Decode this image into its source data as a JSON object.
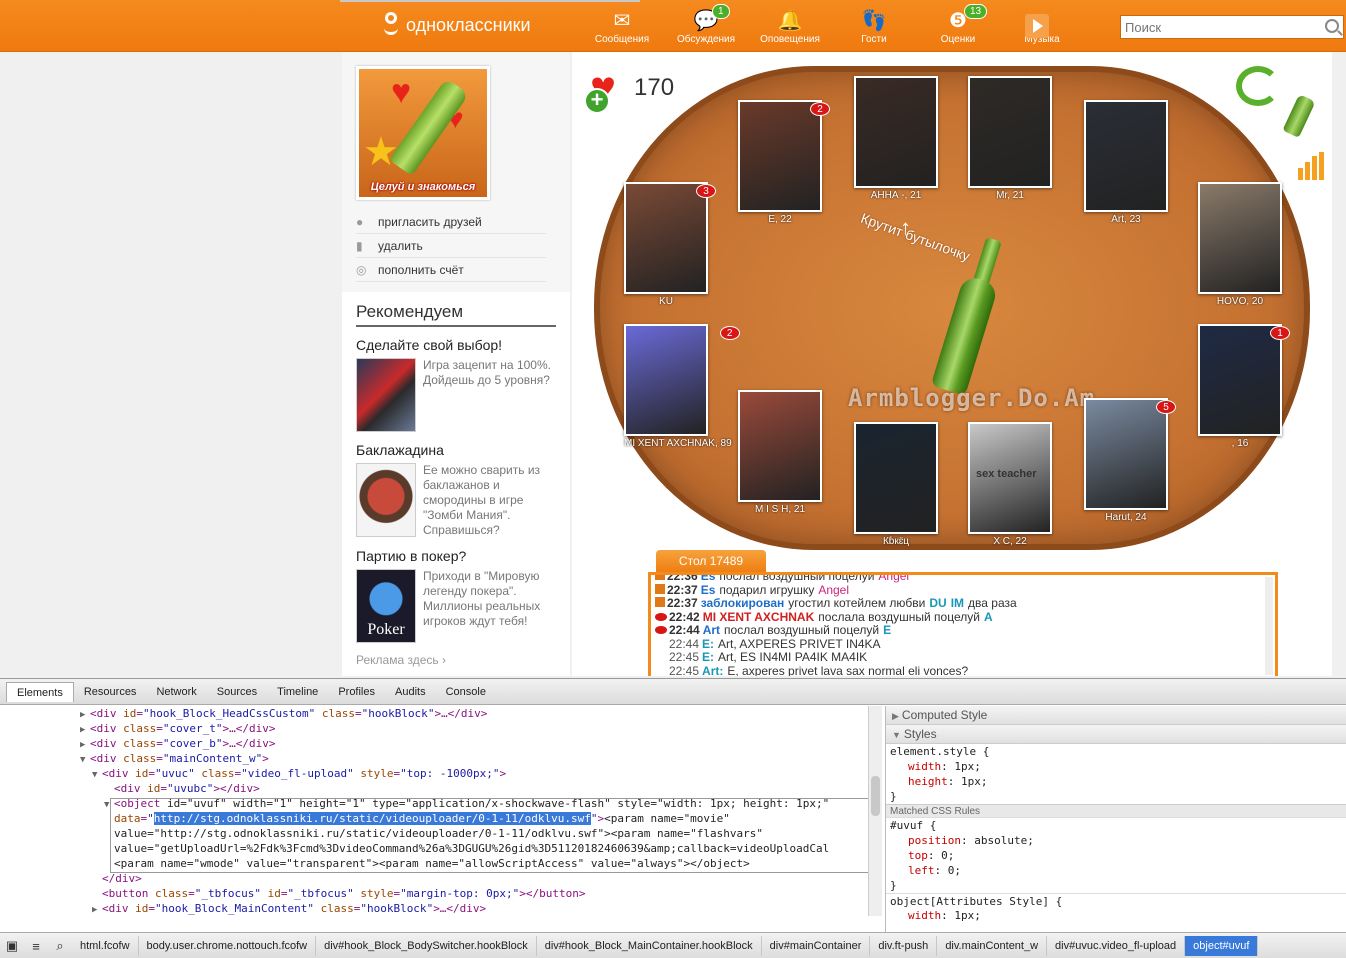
{
  "topbar": {
    "logo_text": "одноклассники",
    "nav": [
      {
        "label": "Сообщения",
        "icon": "envelope-icon",
        "badge": ""
      },
      {
        "label": "Обсуждения",
        "icon": "chat-bubbles-icon",
        "badge": "1"
      },
      {
        "label": "Оповещения",
        "icon": "bell-icon",
        "badge": ""
      },
      {
        "label": "Гости",
        "icon": "footprints-icon",
        "badge": ""
      },
      {
        "label": "Оценки",
        "icon": "rating-five-icon",
        "badge": "13"
      },
      {
        "label": "Музыка",
        "icon": "music-note-icon",
        "badge": ""
      }
    ],
    "search_placeholder": "Поиск"
  },
  "sidebar": {
    "app_caption": "Целуй и знакомься",
    "links": [
      {
        "label": "пригласить друзей",
        "icon": "person-icon"
      },
      {
        "label": "удалить",
        "icon": "trash-icon"
      },
      {
        "label": "пополнить счёт",
        "icon": "coins-icon"
      }
    ],
    "recommend_title": "Рекомендуем",
    "items": [
      {
        "title": "Сделайте свой выбор!",
        "text": "Игра зацепит на 100%. Дойдешь до 5 уровня?"
      },
      {
        "title": "Баклажадина",
        "text": "Ее можно сварить из баклажанов и смородины в игре \"Зомби Мания\". Справишься?"
      },
      {
        "title": "Партию в покер?",
        "text": "Приходи в \"Мировую легенду покера\". Миллионы реальных игроков ждут тебя!",
        "pic_label": "Poker"
      }
    ],
    "ad_link": "Реклама здесь ›"
  },
  "game": {
    "hearts": "170",
    "spin_text": "Крутит бутылочку",
    "watermark": "Armblogger.Do.Am",
    "players": [
      {
        "name": "E, 22",
        "kisses": "2"
      },
      {
        "name": "АННА -, 21",
        "kisses": ""
      },
      {
        "name": "Mr, 21",
        "kisses": ""
      },
      {
        "name": "Art, 23",
        "kisses": ""
      },
      {
        "name": "KU",
        "kisses": "3"
      },
      {
        "name": "HOVO, 20",
        "kisses": ""
      },
      {
        "name": "MI XENT AXCHNAK, 89",
        "kisses": "2"
      },
      {
        "name": ", 16",
        "kisses": "1"
      },
      {
        "name": "M I S H, 21",
        "kisses": ""
      },
      {
        "name": "Кɓкɛ̈ц",
        "kisses": ""
      },
      {
        "name": "X C, 22",
        "kisses": ""
      },
      {
        "name": "Harut, 24",
        "kisses": "5"
      }
    ],
    "photo_colors": [
      "#6a3a2a",
      "#3a2a24",
      "#2e2a26",
      "#2a2e36",
      "#7a4a36",
      "#8a7a6a",
      "#6a6ad8",
      "#1e2a44",
      "#9a4a3a",
      "#1a2430",
      "#c8c8c8",
      "#7a8aa0"
    ],
    "sex_teacher": "sex teacher",
    "table_tab": "Стол 17489",
    "chat": [
      {
        "type": "gift",
        "time": "22:36",
        "parts": [
          [
            "c-blue",
            "Es"
          ],
          [
            "",
            "послал воздушный поцелуй"
          ],
          [
            "c-pink",
            "Angel"
          ]
        ]
      },
      {
        "type": "gift",
        "time": "22:37",
        "parts": [
          [
            "c-blue",
            "Es"
          ],
          [
            "",
            "подарил игрушку"
          ],
          [
            "c-pink",
            "Angel"
          ]
        ]
      },
      {
        "type": "gift",
        "time": "22:37",
        "parts": [
          [
            "c-blue",
            "заблокирован"
          ],
          [
            "",
            "угостил котейлем любви"
          ],
          [
            "c-teal",
            "DU"
          ],
          [
            "c-teal",
            "IM"
          ],
          [
            "",
            "два раза"
          ]
        ]
      },
      {
        "type": "lip",
        "time": "22:42",
        "parts": [
          [
            "c-red",
            "MI XENT AXCHNAK"
          ],
          [
            "",
            "послала воздушный поцелуй"
          ],
          [
            "c-teal",
            "A"
          ]
        ]
      },
      {
        "type": "lip",
        "time": "22:44",
        "parts": [
          [
            "c-blue",
            "Art"
          ],
          [
            "",
            "послал воздушный поцелуй"
          ],
          [
            "c-teal",
            "E"
          ]
        ]
      },
      {
        "type": "plain",
        "time": "22:44",
        "parts": [
          [
            "c-teal",
            "E:"
          ],
          [
            "",
            "Art, AXPERES PRIVET IN4KA"
          ]
        ]
      },
      {
        "type": "plain",
        "time": "22:45",
        "parts": [
          [
            "c-teal",
            "E:"
          ],
          [
            "",
            "Art, ES IN4MI PA4IK MA4IK"
          ]
        ]
      },
      {
        "type": "plain",
        "time": "22:45",
        "parts": [
          [
            "c-teal",
            "Art:"
          ],
          [
            "",
            "E, axperes privet lava sax normal eli vonces?"
          ]
        ]
      }
    ]
  },
  "devtools": {
    "tabs": [
      "Elements",
      "Resources",
      "Network",
      "Sources",
      "Timeline",
      "Profiles",
      "Audits",
      "Console"
    ],
    "code": {
      "l1": {
        "id": "hook_Block_HeadCssCustom",
        "class": "hookBlock"
      },
      "l2": "cover_t",
      "l3": "cover_b",
      "l4": "mainContent_w",
      "l5": {
        "id": "uvuc",
        "class": "video_fl-upload",
        "style": "top: -1000px;"
      },
      "l6": "uvubc",
      "obj_attrs": "id=\"uvuf\" width=\"1\" height=\"1\" type=\"application/x-shockwave-flash\" style=\"width: 1px; height: 1px;\"",
      "obj_data": "http://stg.odnoklassniki.ru/static/videouploader/0-1-11/odklvu.swf",
      "param1": "<param name=\"movie\"",
      "param1_value": "value=\"http://stg.odnoklassniki.ru/static/videouploader/0-1-11/odklvu.swf\"><param name=\"flashvars\"",
      "param2_value": "value=\"getUploadUrl=%2Fdk%3Fcmd%3DvideoCommand%26a%3DGUGU%26gid%3D51120182460639&amp;callback=videoUploadCal",
      "param3": "<param name=\"wmode\" value=\"transparent\"><param name=\"allowScriptAccess\" value=\"always\"></object>",
      "button_line": {
        "class": "_tbfocus",
        "id": "_tbfocus",
        "style": "margin-top: 0px;"
      },
      "last": {
        "id": "hook_Block_MainContent",
        "class": "hookBlock"
      }
    },
    "side": {
      "computed": "Computed Style",
      "styles": "Styles",
      "element_style": "element.style {",
      "es_props": [
        [
          "width",
          "1px"
        ],
        [
          "height",
          "1px"
        ]
      ],
      "matched": "Matched CSS Rules",
      "rule_selector": "#uvuf {",
      "rule_props": [
        [
          "position",
          "absolute"
        ],
        [
          "top",
          "0"
        ],
        [
          "left",
          "0"
        ]
      ],
      "attr_style": "object[Attributes Style] {",
      "attr_props": [
        [
          "width",
          "1px"
        ]
      ]
    },
    "breadcrumbs": [
      "html.fcofw",
      "body.user.chrome.nottouch.fcofw",
      "div#hook_Block_BodySwitcher.hookBlock",
      "div#hook_Block_MainContainer.hookBlock",
      "div#mainContainer",
      "div.ft-push",
      "div.mainContent_w",
      "div#uvuc.video_fl-upload",
      "object#uvuf"
    ]
  }
}
